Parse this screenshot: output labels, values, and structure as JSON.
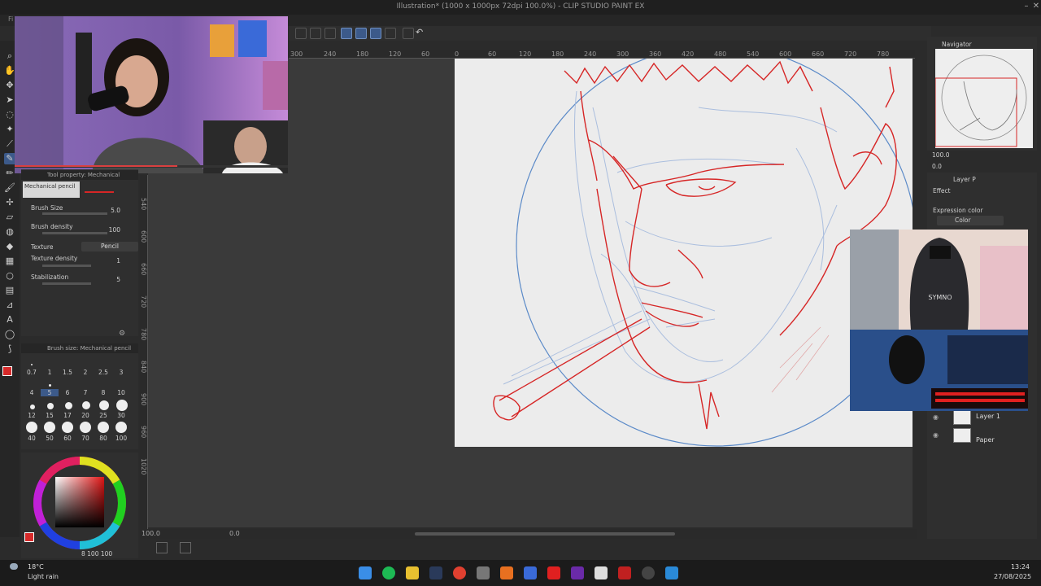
{
  "window": {
    "title": "Illustration* (1000 x 1000px 72dpi 100.0%) - CLIP STUDIO PAINT EX",
    "menu_fragment": "Fi"
  },
  "tool_property": {
    "header": "Tool property: Mechanical pencil",
    "preset_name": "Mechanical pencil",
    "brush_size_label": "Brush Size",
    "brush_size_value": "5.0",
    "brush_density_label": "Brush density",
    "brush_density_value": "100",
    "texture_label": "Texture",
    "texture_value": "Pencil",
    "texture_density_label": "Texture density",
    "texture_density_value": "1",
    "stabilization_label": "Stabilization",
    "stabilization_value": "5"
  },
  "brush_size_panel": {
    "header": "Brush size: Mechanical pencil",
    "sizes": [
      "0.7",
      "1",
      "1.5",
      "2",
      "2.5",
      "3",
      "4",
      "5",
      "6",
      "7",
      "8",
      "10",
      "12",
      "15",
      "17",
      "20",
      "25",
      "30",
      "40",
      "50",
      "60",
      "70",
      "80",
      "100"
    ],
    "selected": "5"
  },
  "color": {
    "main": "#d72a2a",
    "sub": "#ffffff",
    "footer": "8  100  100"
  },
  "rulers": {
    "top": [
      "300",
      "240",
      "180",
      "120",
      "60",
      "0",
      "60",
      "120",
      "180",
      "240",
      "300",
      "360",
      "420",
      "480",
      "540",
      "600",
      "660",
      "720",
      "780"
    ],
    "left": [
      "540",
      "600",
      "660",
      "720",
      "780",
      "840",
      "900",
      "960",
      "1020"
    ]
  },
  "status": {
    "zoom": "100.0",
    "angle": "0.0"
  },
  "navigator": {
    "title": "Navigator",
    "zoom": "100.0",
    "angle": "0.0"
  },
  "layers": {
    "panel_title": "Layer P",
    "effect_label": "Effect",
    "expression_label": "Expression color",
    "expression_value": "Color",
    "rows": [
      {
        "name": "Layer 1"
      },
      {
        "name": "Paper"
      }
    ]
  },
  "taskbar": {
    "weather_temp": "18°C",
    "weather_desc": "Light rain",
    "time": "13:24",
    "date": "27/08/2025"
  },
  "webcam_chair_text": "SYMNO"
}
